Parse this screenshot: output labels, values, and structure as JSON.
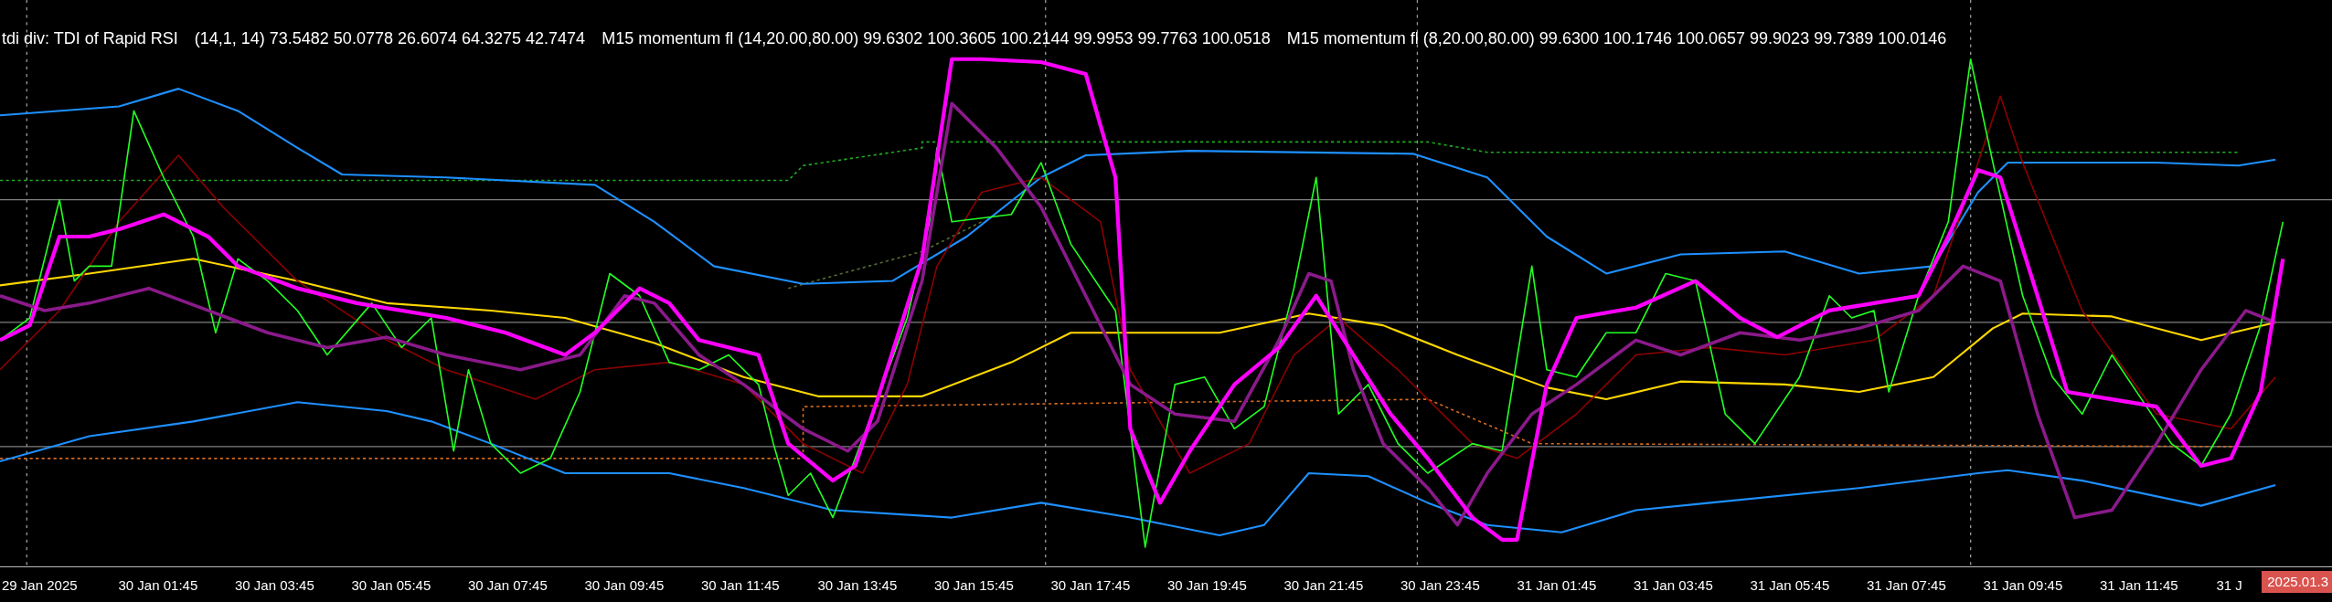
{
  "indicator_header": {
    "name": "tdi div: TDI of Rapid RSI",
    "values": [
      "(14,1, 14) 73.5482 50.0778 26.6074 64.3275 42.7474",
      "M15 momentum fl (14,20.00,80.00) 99.6302 100.3605 100.2144 99.9953 99.7763 100.0518",
      "M15 momentum fl (8,20.00,80.00) 99.6300 100.1746 100.0657 99.9023 99.7389 100.0146"
    ]
  },
  "time_axis": {
    "labels": [
      "29 Jan 2025",
      "30 Jan 01:45",
      "30 Jan 03:45",
      "30 Jan 05:45",
      "30 Jan 07:45",
      "30 Jan 09:45",
      "30 Jan 11:45",
      "30 Jan 13:45",
      "30 Jan 15:45",
      "30 Jan 17:45",
      "30 Jan 19:45",
      "30 Jan 21:45",
      "30 Jan 23:45",
      "31 Jan 01:45",
      "31 Jan 03:45",
      "31 Jan 05:45",
      "31 Jan 07:45",
      "31 Jan 09:45",
      "31 Jan 11:45",
      "31 J"
    ],
    "cursor_time": "2025.01.3"
  }
}
